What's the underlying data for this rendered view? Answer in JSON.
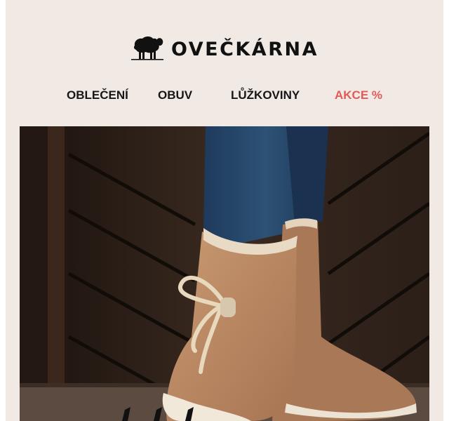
{
  "brand": {
    "name": "OVEČKÁRNA",
    "logo_icon": "sheep-icon"
  },
  "nav": {
    "items": [
      {
        "label": "OBLEČENÍ"
      },
      {
        "label": "OBUV"
      },
      {
        "label": "LŮŽKOVINY"
      },
      {
        "label": "AKCE %"
      }
    ]
  },
  "hero": {
    "subject": "hero-image-sheepskin-boots"
  },
  "colors": {
    "background": "#f1e9e4",
    "text": "#161616",
    "sale": "#e25a58"
  }
}
